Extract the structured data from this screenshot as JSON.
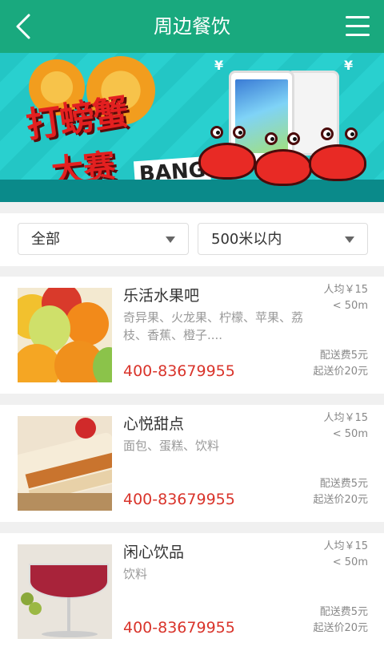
{
  "header": {
    "title": "周边餐饮"
  },
  "banner": {
    "title_line1": "打螃蟹",
    "title_line2": "大赛",
    "bang": "BANG",
    "price_tags": [
      "¥",
      "¥"
    ]
  },
  "filters": {
    "category": "全部",
    "distance": "500米以内"
  },
  "shops": [
    {
      "name": "乐活水果吧",
      "desc": "奇异果、火龙果、柠檬、苹果、荔枝、香蕉、橙子....",
      "phone": "400-83679955",
      "avg_price": "人均￥15",
      "distance": "< 50m",
      "delivery_fee": "配送费5元",
      "min_order": "起送价20元"
    },
    {
      "name": "心悦甜点",
      "desc": "面包、蛋糕、饮料",
      "phone": "400-83679955",
      "avg_price": "人均￥15",
      "distance": "< 50m",
      "delivery_fee": "配送费5元",
      "min_order": "起送价20元"
    },
    {
      "name": "闲心饮品",
      "desc": "饮料",
      "phone": "400-83679955",
      "avg_price": "人均￥15",
      "distance": "< 50m",
      "delivery_fee": "配送费5元",
      "min_order": "起送价20元"
    }
  ],
  "colors": {
    "nav": "#19a97e",
    "phone": "#d9342b",
    "muted": "#999999"
  }
}
